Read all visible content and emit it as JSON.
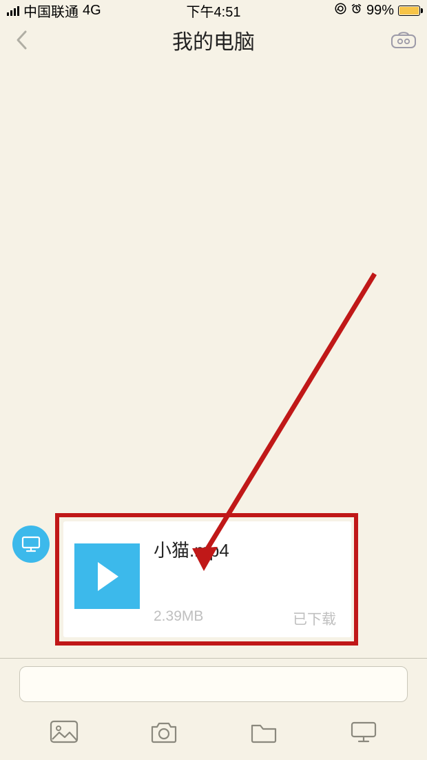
{
  "status": {
    "carrier": "中国联通",
    "network": "4G",
    "time": "下午4:51",
    "battery_percent": "99%"
  },
  "nav": {
    "title": "我的电脑"
  },
  "message": {
    "filename": "小猫.mp4",
    "size": "2.39MB",
    "status": "已下载"
  }
}
